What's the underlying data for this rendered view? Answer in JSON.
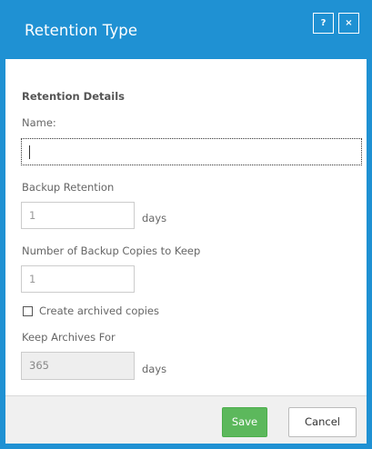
{
  "dialog": {
    "title": "Retention Type",
    "help_label": "?",
    "close_label": "×"
  },
  "form": {
    "section_title": "Retention Details",
    "name_label": "Name:",
    "name_value": "",
    "backup_retention_label": "Backup Retention",
    "backup_retention_value": "1",
    "backup_retention_unit": "days",
    "copies_label": "Number of Backup Copies to Keep",
    "copies_value": "1",
    "archive_checkbox_label": "Create archived copies",
    "archive_checked": false,
    "keep_archives_label": "Keep Archives For",
    "keep_archives_value": "365",
    "keep_archives_unit": "days"
  },
  "footer": {
    "save_label": "Save",
    "cancel_label": "Cancel"
  },
  "colors": {
    "accent": "#1f91d3",
    "save": "#5cb85c"
  }
}
